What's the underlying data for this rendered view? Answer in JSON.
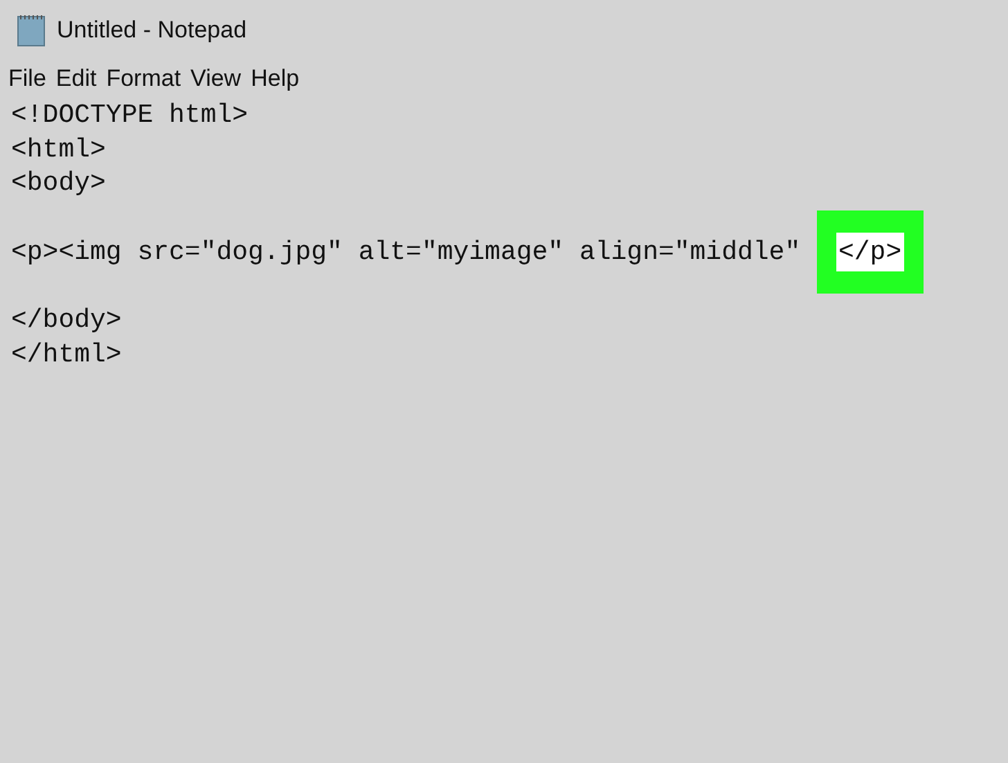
{
  "window": {
    "title": "Untitled - Notepad"
  },
  "menu": [
    "File",
    "Edit",
    "Format",
    "View",
    "Help"
  ],
  "editor": {
    "lines": [
      {
        "kind": "code",
        "segments": [
          {
            "text": "<!DOCTYPE html>",
            "highlighted": false
          }
        ]
      },
      {
        "kind": "code",
        "segments": [
          {
            "text": "<html>",
            "highlighted": false
          }
        ]
      },
      {
        "kind": "code",
        "segments": [
          {
            "text": "<body>",
            "highlighted": false
          }
        ]
      },
      {
        "kind": "blank"
      },
      {
        "kind": "code",
        "segments": [
          {
            "text": "<p><img src=\"dog.jpg\" alt=\"myimage\" align=\"middle\" ",
            "highlighted": false
          },
          {
            "text": "</p>",
            "highlighted": true
          }
        ]
      },
      {
        "kind": "blank"
      },
      {
        "kind": "code",
        "segments": [
          {
            "text": "</body>",
            "highlighted": false
          }
        ]
      },
      {
        "kind": "code",
        "segments": [
          {
            "text": "</html>",
            "highlighted": false
          }
        ]
      }
    ]
  }
}
